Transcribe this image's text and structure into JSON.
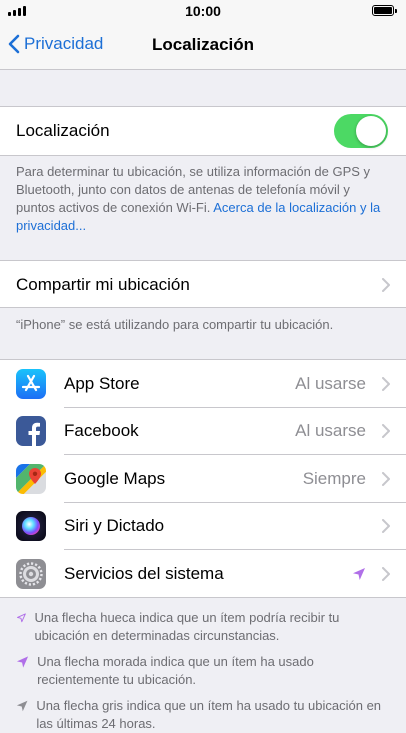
{
  "status_bar": {
    "time": "10:00"
  },
  "nav": {
    "back_label": "Privacidad",
    "title": "Localización"
  },
  "location_toggle": {
    "label": "Localización",
    "state": "on",
    "on_color": "#4cd964"
  },
  "location_description": {
    "text": "Para determinar tu ubicación, se utiliza información de GPS y Bluetooth, junto con datos de antenas de telefonía móvil y puntos activos de conexión Wi-Fi. ",
    "link": "Acerca de la localización y la privacidad..."
  },
  "share_location": {
    "label": "Compartir mi ubicación"
  },
  "share_footer": "“iPhone” se está utilizando para compartir tu ubicación.",
  "apps": [
    {
      "name": "App Store",
      "value": "Al usarse",
      "icon": "app-store-icon"
    },
    {
      "name": "Facebook",
      "value": "Al usarse",
      "icon": "facebook-icon"
    },
    {
      "name": "Google Maps",
      "value": "Siempre",
      "icon": "google-maps-icon"
    },
    {
      "name": "Siri y Dictado",
      "value": "",
      "icon": "siri-icon"
    },
    {
      "name": "Servicios del sistema",
      "value": "",
      "icon": "settings-gear-icon",
      "indicator": "purple-arrow"
    }
  ],
  "legend": [
    {
      "text": "Una flecha hueca indica que un ítem podría recibir tu ubicación en determinadas circunstancias.",
      "arrow": "hollow-purple"
    },
    {
      "text": "Una flecha morada indica que un ítem ha usado recientemente tu ubicación.",
      "arrow": "purple"
    },
    {
      "text": "Una flecha gris indica que un ítem ha usado tu ubicación en las últimas 24 horas.",
      "arrow": "gray"
    }
  ],
  "colors": {
    "accent": "#1c6fd6",
    "purple_arrow": "#b06fe8",
    "gray_arrow": "#8e8e93"
  }
}
